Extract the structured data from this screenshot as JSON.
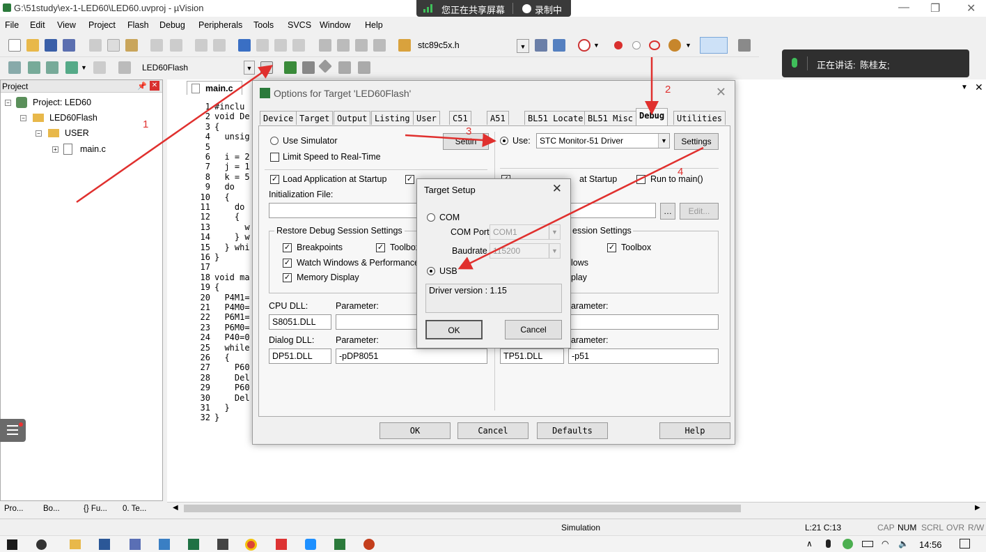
{
  "window": {
    "title": "G:\\51study\\ex-1-LED60\\LED60.uvproj - µVision",
    "share_status": "您正在共享屏幕",
    "recording": "录制中"
  },
  "menu": [
    "File",
    "Edit",
    "View",
    "Project",
    "Flash",
    "Debug",
    "Peripherals",
    "Tools",
    "SVCS",
    "Window",
    "Help"
  ],
  "toolbar": {
    "file_combo": "stc89c5x.h",
    "target_combo": "LED60Flash"
  },
  "speaking": {
    "label": "正在讲话:",
    "name": "陈桂友;"
  },
  "project": {
    "header": "Project",
    "tree": [
      "Project: LED60",
      "LED60Flash",
      "USER",
      "main.c"
    ],
    "tabs": [
      "Pro...",
      "Bo...",
      "{} Fu...",
      "0. Te..."
    ]
  },
  "editor": {
    "tab": "main.c",
    "lines": [
      "1",
      "2",
      "3",
      "4",
      "5",
      "6",
      "7",
      "8",
      "9",
      "10",
      "11",
      "12",
      "13",
      "14",
      "15",
      "16",
      "17",
      "18",
      "19",
      "20",
      "21",
      "22",
      "23",
      "24",
      "25",
      "26",
      "27",
      "28",
      "29",
      "30",
      "31",
      "32"
    ],
    "code": [
      "#inclu",
      "void De",
      "{",
      "  unsig",
      "",
      "  i = 2",
      "  j = 1",
      "  k = 5",
      "  do",
      "  {",
      "    do",
      "    {",
      "      w",
      "    } w",
      "  } whi",
      "}",
      "",
      "void ma",
      "{",
      "  P4M1=",
      "  P4M0=",
      "  P6M1=",
      "  P6M0=",
      "  P40=0",
      "  while",
      "  {",
      "    P60",
      "    Del",
      "    P60",
      "    Del",
      "  }",
      "}"
    ]
  },
  "status": {
    "mode": "Simulation",
    "pos": "L:21 C:13",
    "cap": "CAP",
    "num": "NUM",
    "scrl": "SCRL",
    "ovr": "OVR",
    "rw": "R/W"
  },
  "taskbar": {
    "time": "14:56"
  },
  "options": {
    "title": "Options for Target 'LED60Flash'",
    "tabs": [
      "Device",
      "Target",
      "Output",
      "Listing",
      "User",
      "C51",
      "A51",
      "BL51 Locate",
      "BL51 Misc",
      "Debug",
      "Utilities"
    ],
    "use_simulator": "Use Simulator",
    "settings": "Settings",
    "limit_speed": "Limit Speed to Real-Time",
    "load_app": "Load Application at Startup",
    "run_to": "Run to main()",
    "init_file": "Initialization File:",
    "edit_button": "Edit...",
    "restore": "Restore Debug Session Settings",
    "restore_right": "ession Settings",
    "breakpoints": "Breakpoints",
    "toolbox": "Toolbox",
    "watch": "Watch Windows & Performance A",
    "watch_right": "lows",
    "memory": "Memory Display",
    "memory_right": "play",
    "cpu_dll": "CPU DLL:",
    "parameter": "Parameter:",
    "parameter_right": "arameter:",
    "cpu_dll_val": "S8051.DLL",
    "dialog_dll": "Dialog DLL:",
    "dialog_dll_val": "DP51.DLL",
    "dialog_param_val": "-pDP8051",
    "right_dialog_dll": "TP51.DLL",
    "right_dialog_param": "-p51",
    "use": "Use:",
    "driver": "STC Monitor-51 Driver",
    "load_app_right": "at Startup",
    "ok": "OK",
    "cancel": "Cancel",
    "defaults": "Defaults",
    "help": "Help",
    "settings_left": "Settin"
  },
  "target_setup": {
    "title": "Target Setup",
    "com": "COM",
    "com_port_label": "COM Port",
    "com_port_val": "COM1",
    "baud_label": "Baudrate",
    "baud_val": "115200",
    "usb": "USB",
    "driver_version": "Driver version : 1.15",
    "ok": "OK",
    "cancel": "Cancel"
  },
  "annotations": [
    "1",
    "2",
    "3",
    "4"
  ],
  "colors": {
    "arrow": "#e0302e",
    "accent": "#0078d7"
  }
}
